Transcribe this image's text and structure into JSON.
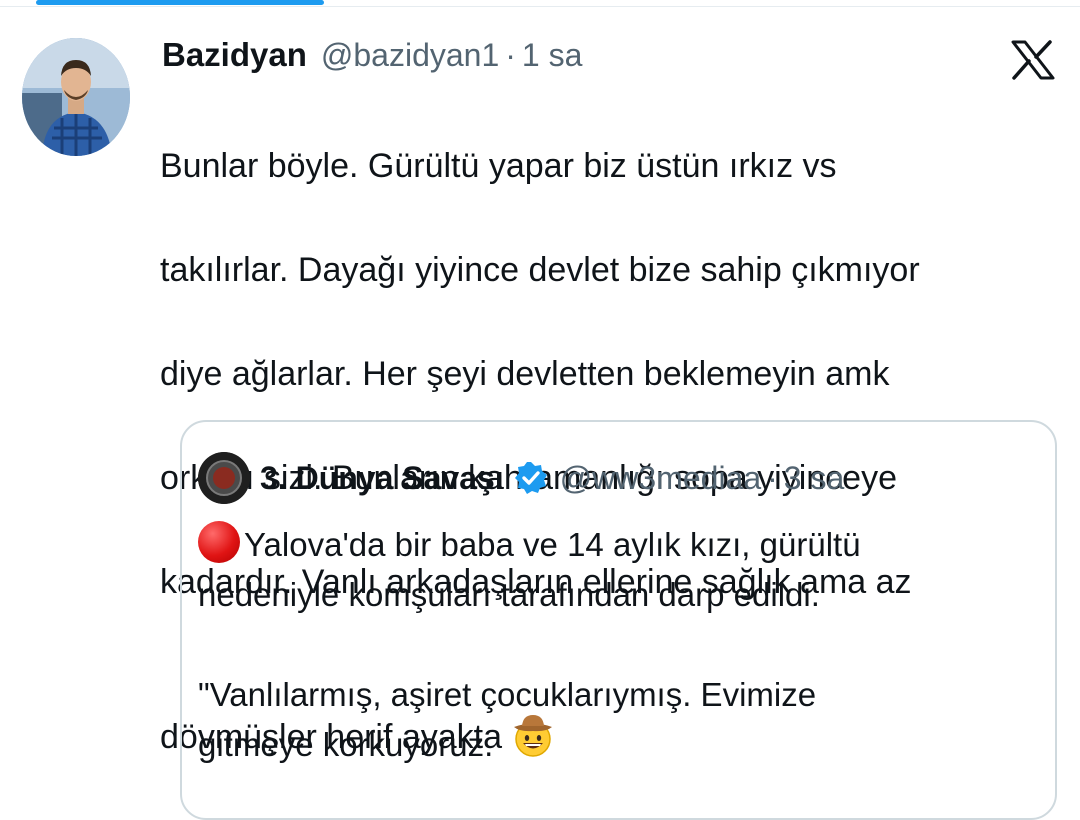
{
  "tweet": {
    "display_name": "Bazidyan",
    "handle": "@bazidyan1",
    "separator": "·",
    "time": "1 sa",
    "text_lines": [
      "Bunlar böyle. Gürültü yapar biz üstün ırkız vs",
      "takılırlar. Dayağı yiyince devlet bize sahip çıkmıyor",
      "diye ağlarlar. Her şeyi devletten beklemeyin amk",
      "orkları sizi. Bunların kahramanlığı sopa yiyinceye",
      "kadardır. Vanlı arkadaşların ellerine sağlık ama az",
      "dövmüşler herif ayakta"
    ],
    "emoji_icon": "cowboy-hat-face-emoji"
  },
  "quoted_tweet": {
    "display_name": "3. Dünya Savaşı",
    "handle": "@ww3mediaa",
    "separator": "·",
    "time": "3 sa",
    "verified_icon": "verified-badge-icon",
    "bullet_icon": "red-circle-emoji",
    "text_lines": [
      "Yalova'da bir baba ve 14 aylık kızı, gürültü",
      "nedeniyle komşuları tarafından darp edildi.",
      "",
      "\"Vanlılarmış, aşiret çocuklarıymış. Evimize",
      "gitmeye korkuyoruz."
    ]
  },
  "brand_icon": "x-logo-icon",
  "colors": {
    "text": "#0f1419",
    "secondary": "#536471",
    "accent": "#1d9bf0",
    "border": "#cfd9de"
  }
}
